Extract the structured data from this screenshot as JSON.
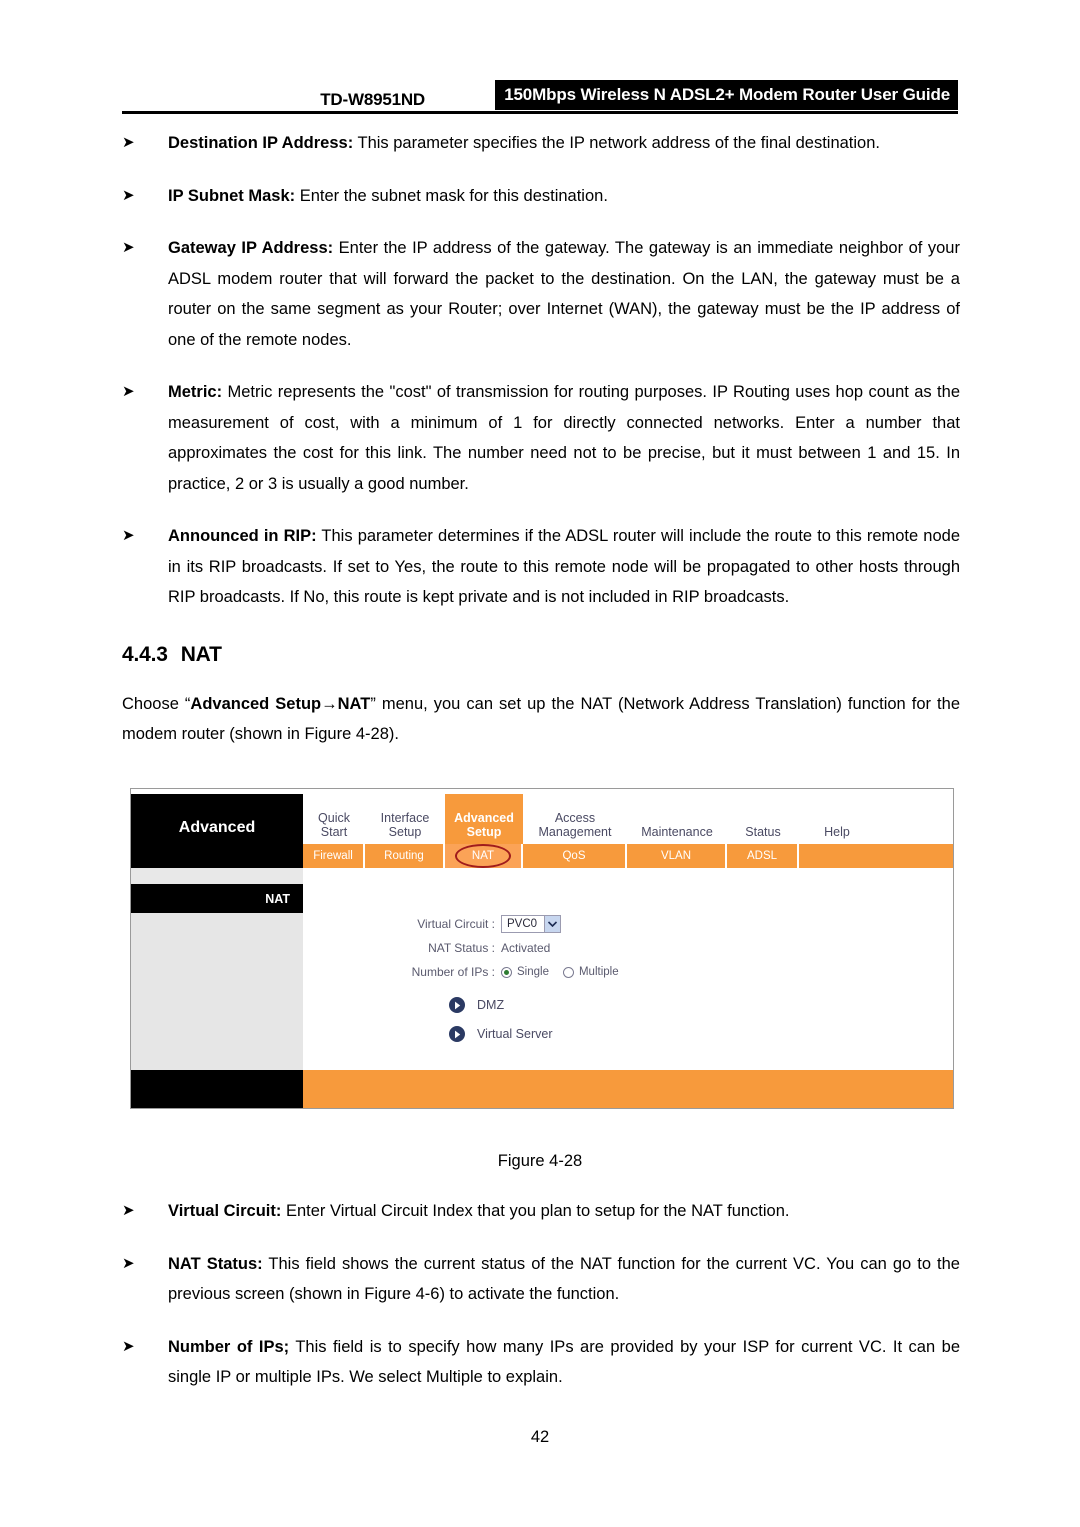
{
  "header": {
    "model": "TD-W8951ND",
    "title": "150Mbps Wireless N ADSL2+ Modem Router User Guide"
  },
  "bullets_upper": [
    {
      "arrow": "➤",
      "term": "Destination IP Address:",
      "text": " This parameter specifies the IP network address of the final destination."
    },
    {
      "arrow": "➤",
      "term": "IP Subnet Mask:",
      "text": " Enter the subnet mask for this destination."
    },
    {
      "arrow": "➤",
      "term": "Gateway IP Address:",
      "text": " Enter the IP address of the gateway. The gateway is an immediate neighbor of your ADSL modem router that will forward the packet to the destination. On the LAN, the gateway must be a router on the same segment as your Router; over Internet (WAN), the gateway must be the IP address of one of the remote nodes."
    },
    {
      "arrow": "➤",
      "term": "Metric:",
      "text": " Metric represents the \"cost\" of transmission for routing purposes. IP Routing uses hop count as the measurement of cost, with a minimum of 1 for directly connected networks. Enter a number that approximates the cost for this link. The number need not to be precise, but it must between 1 and 15. In practice, 2 or 3 is usually a good number."
    },
    {
      "arrow": "➤",
      "term": "Announced in RIP:",
      "text": " This parameter determines if the ADSL router will include the route to this remote node in its RIP broadcasts. If set to Yes, the route to this remote node will be propagated to other hosts through RIP broadcasts. If No, this route is kept private and is not included in RIP broadcasts."
    }
  ],
  "section": {
    "number": "4.4.3",
    "title": "NAT"
  },
  "intro": {
    "lead": "Choose “",
    "menu_path": "Advanced Setup→NAT",
    "tail": "” menu, you can set up the NAT (Network Address Translation) function for the modem router (shown in Figure 4-28)."
  },
  "figure": {
    "caption": "Figure 4-28",
    "brand": "Advanced",
    "nav_tabs": [
      {
        "label": "Quick\nStart",
        "active": false
      },
      {
        "label": "Interface\nSetup",
        "active": false
      },
      {
        "label": "Advanced\nSetup",
        "active": true
      },
      {
        "label": "Access\nManagement",
        "active": false
      },
      {
        "label": "Maintenance",
        "active": false
      },
      {
        "label": "Status",
        "active": false
      },
      {
        "label": "Help",
        "active": false
      }
    ],
    "sub_tabs": [
      {
        "label": "Firewall",
        "selected": false
      },
      {
        "label": "Routing",
        "selected": false
      },
      {
        "label": "NAT",
        "selected": true
      },
      {
        "label": "QoS",
        "selected": false
      },
      {
        "label": "VLAN",
        "selected": false
      },
      {
        "label": "ADSL",
        "selected": false
      }
    ],
    "sidebar_title": "NAT",
    "form": {
      "virtual_circuit_label": "Virtual Circuit :",
      "virtual_circuit_value": "PVC0",
      "nat_status_label": "NAT Status :",
      "nat_status_value": "Activated",
      "number_of_ips_label": "Number of IPs :",
      "radio_single": "Single",
      "radio_multiple": "Multiple",
      "selected_radio": "Single"
    },
    "links": [
      {
        "label": "DMZ"
      },
      {
        "label": "Virtual Server"
      }
    ],
    "colors": {
      "accent_orange": "#f79a3c",
      "sub_selected_orange": "#fba357",
      "annotation_red": "#a01c1c",
      "icon_navy": "#2b3a63"
    }
  },
  "bullets_lower": [
    {
      "arrow": "➤",
      "term": "Virtual Circuit:",
      "text": " Enter Virtual Circuit Index that you plan to setup for the NAT function."
    },
    {
      "arrow": "➤",
      "term": "NAT Status:",
      "text": " This field shows the current status of the NAT function for the current VC. You can go to the previous screen (shown in Figure 4-6) to activate the function."
    },
    {
      "arrow": "➤",
      "term": "Number of IPs;",
      "text": " This field is to specify how many IPs are provided by your ISP for current VC. It can be single IP or multiple IPs. We select Multiple to explain."
    }
  ],
  "page_number": "42"
}
